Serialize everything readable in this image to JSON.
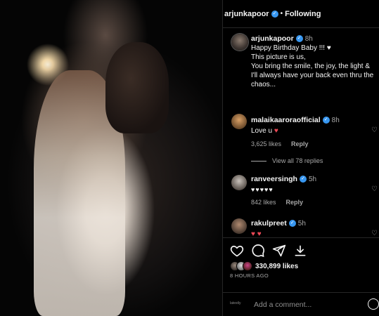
{
  "post": {
    "author": "arjunkapoor",
    "follow_state": "Following",
    "separator": "•",
    "caption": {
      "author": "arjunkapoor",
      "time": "8h",
      "lines": [
        "Happy Birthday Baby !!! ♥",
        "This picture is us,",
        "You bring the smile, the joy, the light &",
        "I'll always have your back even thru the",
        "chaos..."
      ]
    }
  },
  "comments": [
    {
      "author": "malaikaaroraofficial",
      "time": "8h",
      "text": "Love u",
      "heart": "♥",
      "likes": "3,625 likes",
      "reply": "Reply"
    },
    {
      "author": "ranveersingh",
      "time": "5h",
      "text": "♥♥♥♥♥",
      "likes": "842 likes",
      "reply": "Reply"
    },
    {
      "author": "rakulpreet",
      "time": "5h",
      "text": "♥ ♥",
      "likes": "",
      "reply": ""
    }
  ],
  "view_replies": "View all 78 replies",
  "stats": {
    "likes": "330,899 likes",
    "timestamp": "8 HOURS AGO"
  },
  "composer": {
    "placeholder": "Add a comment...",
    "brand": "latestly"
  },
  "icons": [
    "verified-badge-icon",
    "heart-icon",
    "comment-icon",
    "share-icon",
    "save-icon",
    "emoji-icon"
  ],
  "colors": {
    "background": "#000000",
    "text": "#f5f5f5",
    "muted": "#a8a8a8",
    "verified": "#3897f0",
    "heart": "#ed4956"
  }
}
